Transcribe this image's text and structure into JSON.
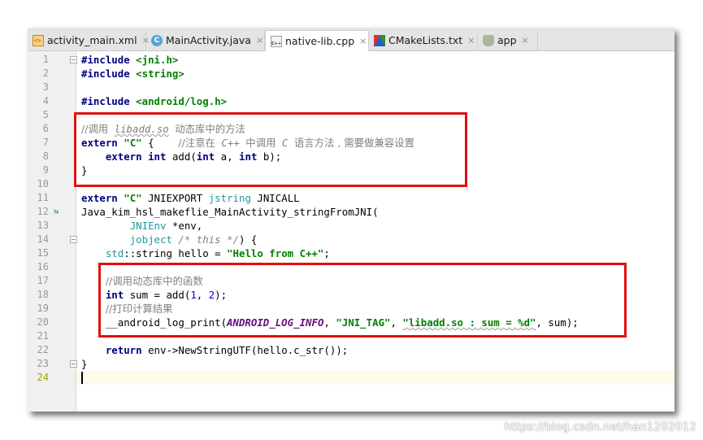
{
  "tabs": [
    {
      "label": "activity_main.xml",
      "icon": "xml-file-icon",
      "active": false
    },
    {
      "label": "MainActivity.java",
      "icon": "java-class-icon",
      "active": false
    },
    {
      "label": "native-lib.cpp",
      "icon": "cpp-file-icon",
      "active": true
    },
    {
      "label": "CMakeLists.txt",
      "icon": "cmake-file-icon",
      "active": false
    },
    {
      "label": "app",
      "icon": "gradle-icon",
      "active": false
    }
  ],
  "tab_close_glyph": "×",
  "java_icon_letter": "C",
  "line_numbers": [
    "1",
    "2",
    "3",
    "4",
    "5",
    "6",
    "7",
    "8",
    "9",
    "10",
    "11",
    "12",
    "13",
    "14",
    "15",
    "16",
    "17",
    "18",
    "19",
    "20",
    "21",
    "22",
    "23",
    "24"
  ],
  "current_line": "24",
  "gutter_marker_glyph": "⇆",
  "code": {
    "l1": {
      "kw": "#include",
      "val": "<jni.h>"
    },
    "l2": {
      "kw": "#include",
      "val": "<string>"
    },
    "l4": {
      "kw": "#include",
      "val": "<android/log.h>"
    },
    "l6": {
      "cm_a": "//调用",
      "cm_b": "libadd.so",
      "cm_c": "动态库中的方法"
    },
    "l7": {
      "kw": "extern",
      "str": "\"C\"",
      "brace": "{",
      "cm_a": "//注意在",
      "cm_b": "C++",
      "cm_c": "中调用",
      "cm_d": "C",
      "cm_e": "语言方法 , 需要做兼容设置"
    },
    "l8": {
      "kw1": "extern",
      "kw2": "int",
      "fn": "add(",
      "kw3": "int",
      "p1": "a, ",
      "kw4": "int",
      "p2": "b);"
    },
    "l9": {
      "text": "}"
    },
    "l11": {
      "kw": "extern",
      "str": "\"C\"",
      "rest": "JNIEXPORT",
      "tp": "jstring",
      "rest2": "JNICALL"
    },
    "l12": {
      "text": "Java_kim_hsl_makeflie_MainActivity_stringFromJNI("
    },
    "l13": {
      "tp": "JNIEnv",
      "rest": "*env,"
    },
    "l14": {
      "tp": "jobject",
      "cm": "/* this */",
      "rest": ") {"
    },
    "l15": {
      "ns": "std",
      "rest": "::string hello = ",
      "str": "\"Hello from C++\"",
      "end": ";"
    },
    "l17": {
      "cm": "//调用动态库中的函数"
    },
    "l18": {
      "kw": "int",
      "rest": "sum = add(",
      "n1": "1",
      "sep": ", ",
      "n2": "2",
      "end": ");"
    },
    "l19": {
      "cm": "//打印计算结果"
    },
    "l20": {
      "fn": "__android_log_print(",
      "mac": "ANDROID_LOG_INFO",
      "sep1": ", ",
      "s1": "\"JNI_TAG\"",
      "sep2": ", ",
      "s2": "\"libadd.so : sum = %d\"",
      "end": ", sum);"
    },
    "l22": {
      "kw": "return",
      "rest": "env->NewStringUTF(hello.c_str());"
    },
    "l23": {
      "text": "}"
    }
  },
  "watermark": "https://blog.csdn.net/han1202012",
  "colors": {
    "highlight_box": "#e01010",
    "keyword": "#000080",
    "string": "#008000",
    "comment": "#808080"
  }
}
